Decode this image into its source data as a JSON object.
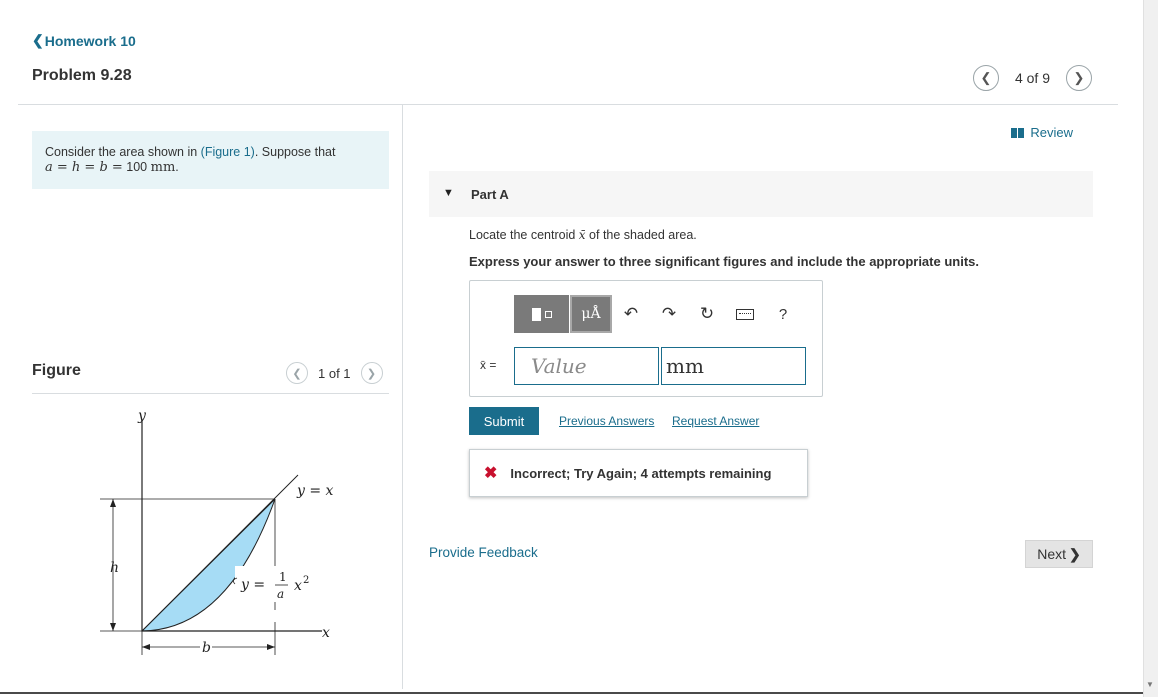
{
  "header": {
    "back_label": "Homework 10",
    "problem_title": "Problem 9.28",
    "pager_text": "4 of 9"
  },
  "info": {
    "text_before": "Consider the area shown in ",
    "figure_link": "(Figure 1)",
    "text_after": ". Suppose that",
    "equation_vars": "a = h = b =",
    "equation_value": "100",
    "equation_unit": "mm",
    "equation_period": "."
  },
  "figure": {
    "title": "Figure",
    "pager_text": "1 of 1",
    "labels": {
      "y_axis": "y",
      "x_axis": "x",
      "line_eq": "y = x",
      "curve_lhs": "y =",
      "curve_num": "1",
      "curve_den": "a",
      "curve_x": "x",
      "curve_exp": "2",
      "h": "h",
      "b": "b"
    },
    "fill_color": "#a6dcf5"
  },
  "review": {
    "label": "Review"
  },
  "part_a": {
    "label": "Part A",
    "question_before": "Locate the centroid ",
    "question_var": "x̄",
    "question_after": " of the shaded area.",
    "instruction": "Express your answer to three significant figures and include the appropriate units.",
    "mu_label": "μÅ",
    "help_label": "?",
    "variable_label": "x̄ =",
    "value_placeholder": "Value",
    "unit_value": "mm",
    "submit_label": "Submit",
    "previous_answers": "Previous Answers",
    "request_answer": "Request Answer",
    "feedback": "Incorrect; Try Again; 4 attempts remaining"
  },
  "footer": {
    "provide_feedback": "Provide Feedback",
    "next_label": "Next"
  },
  "colors": {
    "link": "#1a6d8c",
    "error": "#c8102e",
    "submit_bg": "#1a6d8c"
  }
}
